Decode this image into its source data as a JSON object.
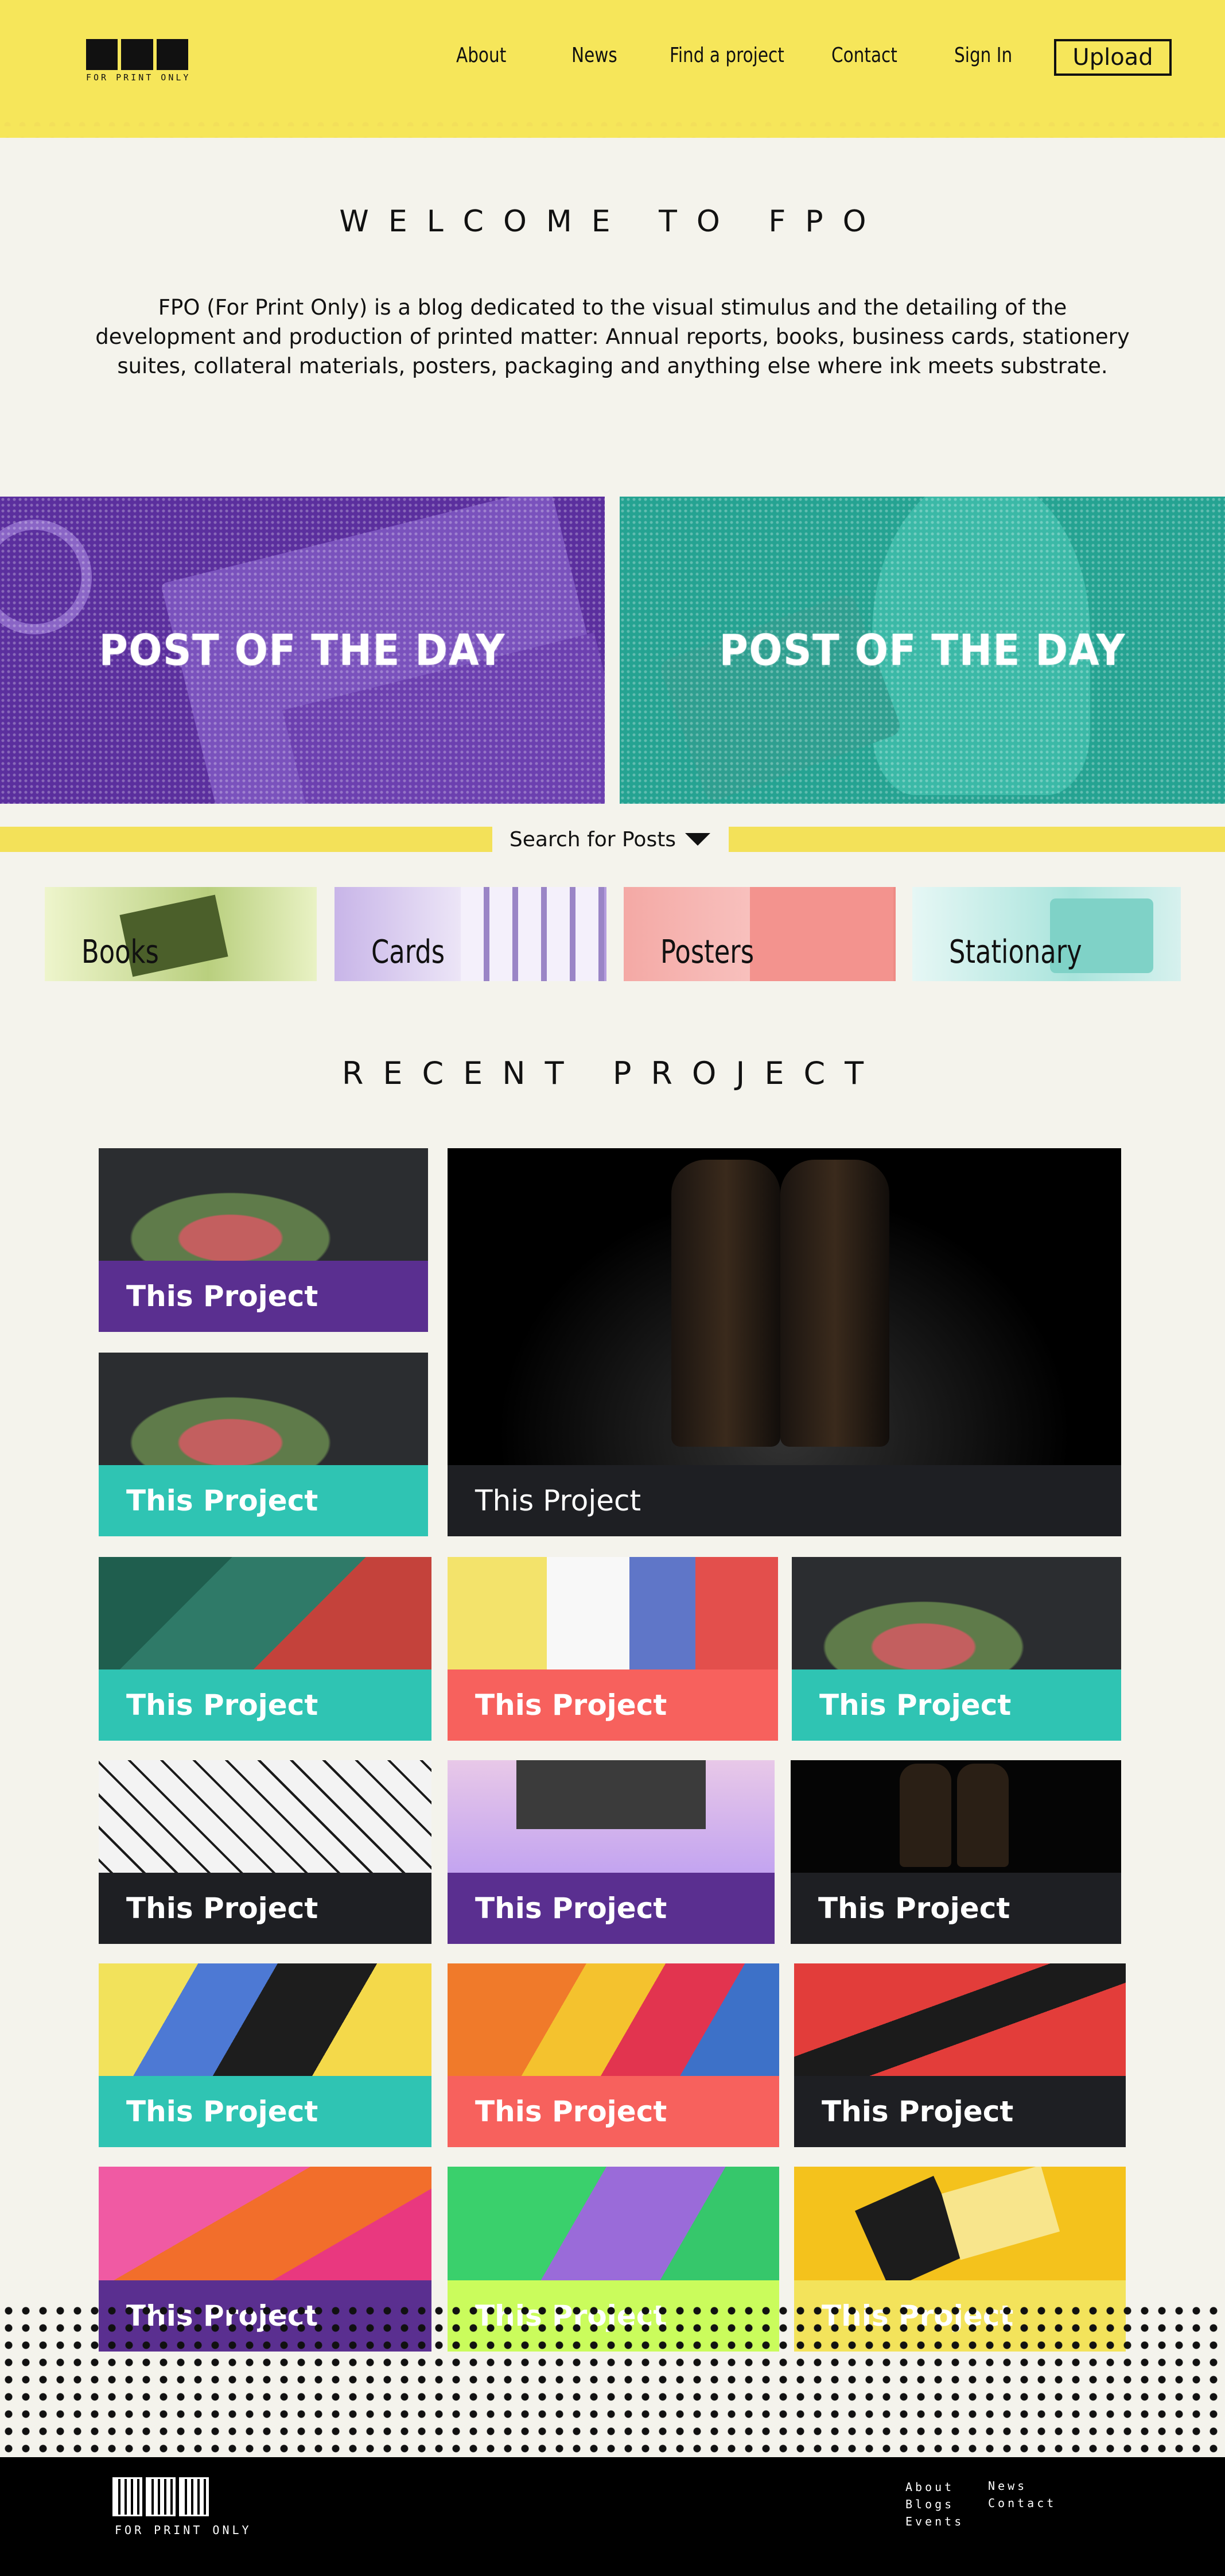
{
  "header": {
    "logo_text": "FPO",
    "logo_tagline": "FOR PRINT ONLY",
    "nav": [
      "About",
      "News",
      "Find a project",
      "Contact",
      "Sign In"
    ],
    "upload_label": "Upload"
  },
  "welcome": {
    "title": "WELCOME TO FPO",
    "text": "FPO (For Print Only) is a blog dedicated to the visual stimulus and the detailing of the development and production of printed matter: Annual reports, books, business cards, stationery suites, collateral materials, posters, packaging and anything else where ink meets substrate."
  },
  "post_of_day": {
    "left_title": "POST OF THE DAY",
    "right_title": "POST OF THE DAY"
  },
  "search": {
    "label": "Search for Posts"
  },
  "categories": [
    "Books",
    "Cards",
    "Posters",
    "Stationary"
  ],
  "recent": {
    "title": "RECENT PROJECT"
  },
  "projects": [
    "This Project",
    "This Project",
    "This Project",
    "This Project",
    "This Project",
    "This Project",
    "This Project",
    "This Project",
    "This Project",
    "This Project",
    "This Project",
    "This Project",
    "This Project",
    "This Project",
    "This Project",
    "This Project",
    "This Project"
  ],
  "footer": {
    "logo_tagline": "FOR PRINT ONLY",
    "links_col1": [
      "About",
      "Blogs",
      "Events"
    ],
    "links_col2": [
      "News",
      "Contact"
    ]
  }
}
